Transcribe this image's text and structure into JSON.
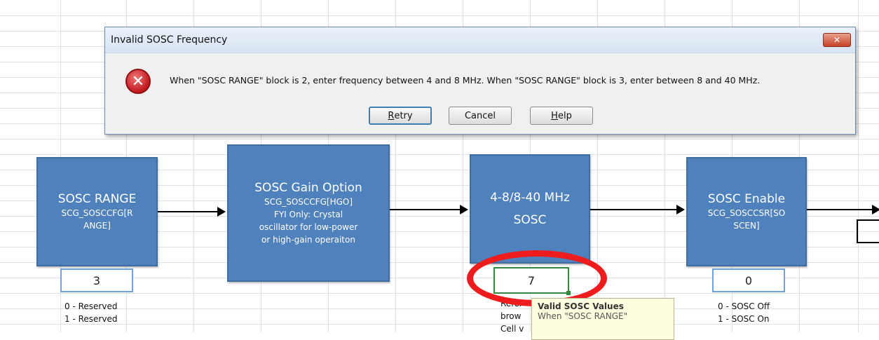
{
  "dialog": {
    "title": "Invalid SOSC Frequency",
    "close_label": "✕",
    "icon": "error-icon",
    "message": "When \"SOSC RANGE\" block is 2, enter frequency between 4 and 8 MHz. When \"SOSC RANGE\" block is 3, enter between 8 and 40 MHz.",
    "buttons": [
      {
        "label_u": "R",
        "label_rest": "etry"
      },
      {
        "label": "Cancel"
      },
      {
        "label_u": "H",
        "label_rest": "elp"
      }
    ]
  },
  "blocks": [
    {
      "title": "SOSC RANGE",
      "lines": [
        "SCG_SOSCCFG[R",
        "ANGE]"
      ]
    },
    {
      "title": "SOSC Gain Option",
      "lines": [
        "SCG_SOSCCFG[HGO]",
        "FYI Only: Crystal",
        "oscillator for low-power",
        "or high-gain operaiton"
      ]
    },
    {
      "title": "4-8/8-40 MHz",
      "title2": "SOSC"
    },
    {
      "title": "SOSC Enable",
      "lines": [
        "SCG_SOSCCSR[SO",
        "SCEN]"
      ]
    }
  ],
  "cells": {
    "range_value": "3",
    "freq_value": "7",
    "enable_value": "0"
  },
  "notes": {
    "range": [
      "0 - Reserved",
      "1 - Reserved"
    ],
    "enable": [
      "0 - SOSC Off",
      "1 - SOSC On"
    ],
    "freq": [
      "Refer",
      "brow",
      "Cell v"
    ]
  },
  "tooltip": {
    "title": "Valid SOSC Values",
    "body": "When \"SOSC RANGE\""
  },
  "colors": {
    "block_fill": "#4f81bd",
    "highlight_ring": "#ee1c1c"
  }
}
